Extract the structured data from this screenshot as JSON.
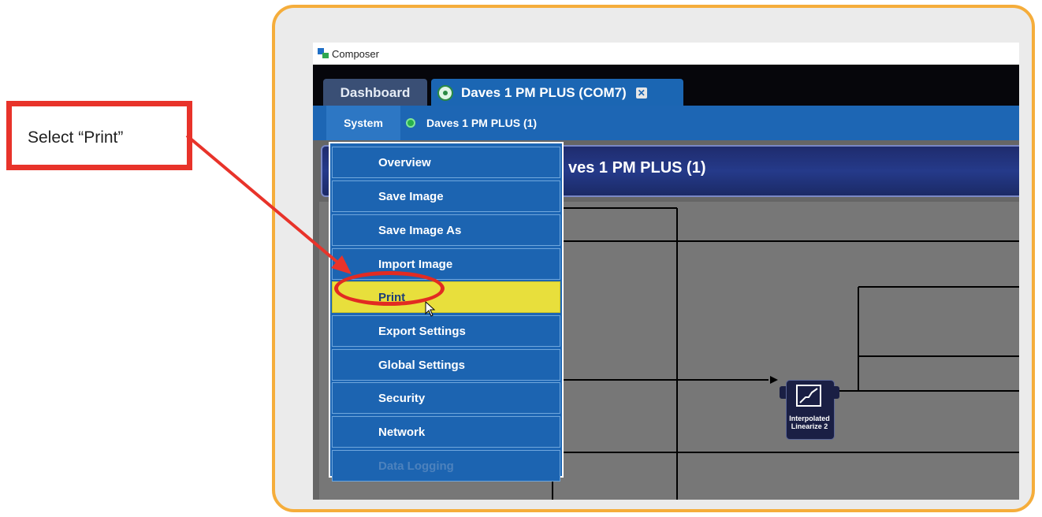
{
  "callout": {
    "text": "Select “Print”"
  },
  "window": {
    "title": "Composer"
  },
  "tabs": [
    {
      "label": "Dashboard"
    },
    {
      "label": "Daves 1 PM PLUS (COM7)",
      "close": "✕"
    }
  ],
  "subbar": {
    "system_label": "System",
    "breadcrumb": "Daves 1 PM PLUS (1)"
  },
  "header": {
    "title": "ves 1 PM PLUS (1)"
  },
  "menu": {
    "items": [
      {
        "label": "Overview"
      },
      {
        "label": "Save Image"
      },
      {
        "label": "Save Image As"
      },
      {
        "label": "Import Image"
      },
      {
        "label": "Print",
        "selected": true
      },
      {
        "label": "Export Settings"
      },
      {
        "label": "Global Settings"
      },
      {
        "label": "Security"
      },
      {
        "label": "Network"
      },
      {
        "label": "Data Logging",
        "disabled": true
      }
    ]
  },
  "block": {
    "label_line1": "Interpolated",
    "label_line2": "Linearize 2"
  },
  "colors": {
    "callout_border": "#e8332a",
    "frame_border": "#f5ad3b",
    "menu_blue": "#1d66b4",
    "selected_yellow": "#e8df3c",
    "highlight_red": "#e22b22"
  }
}
